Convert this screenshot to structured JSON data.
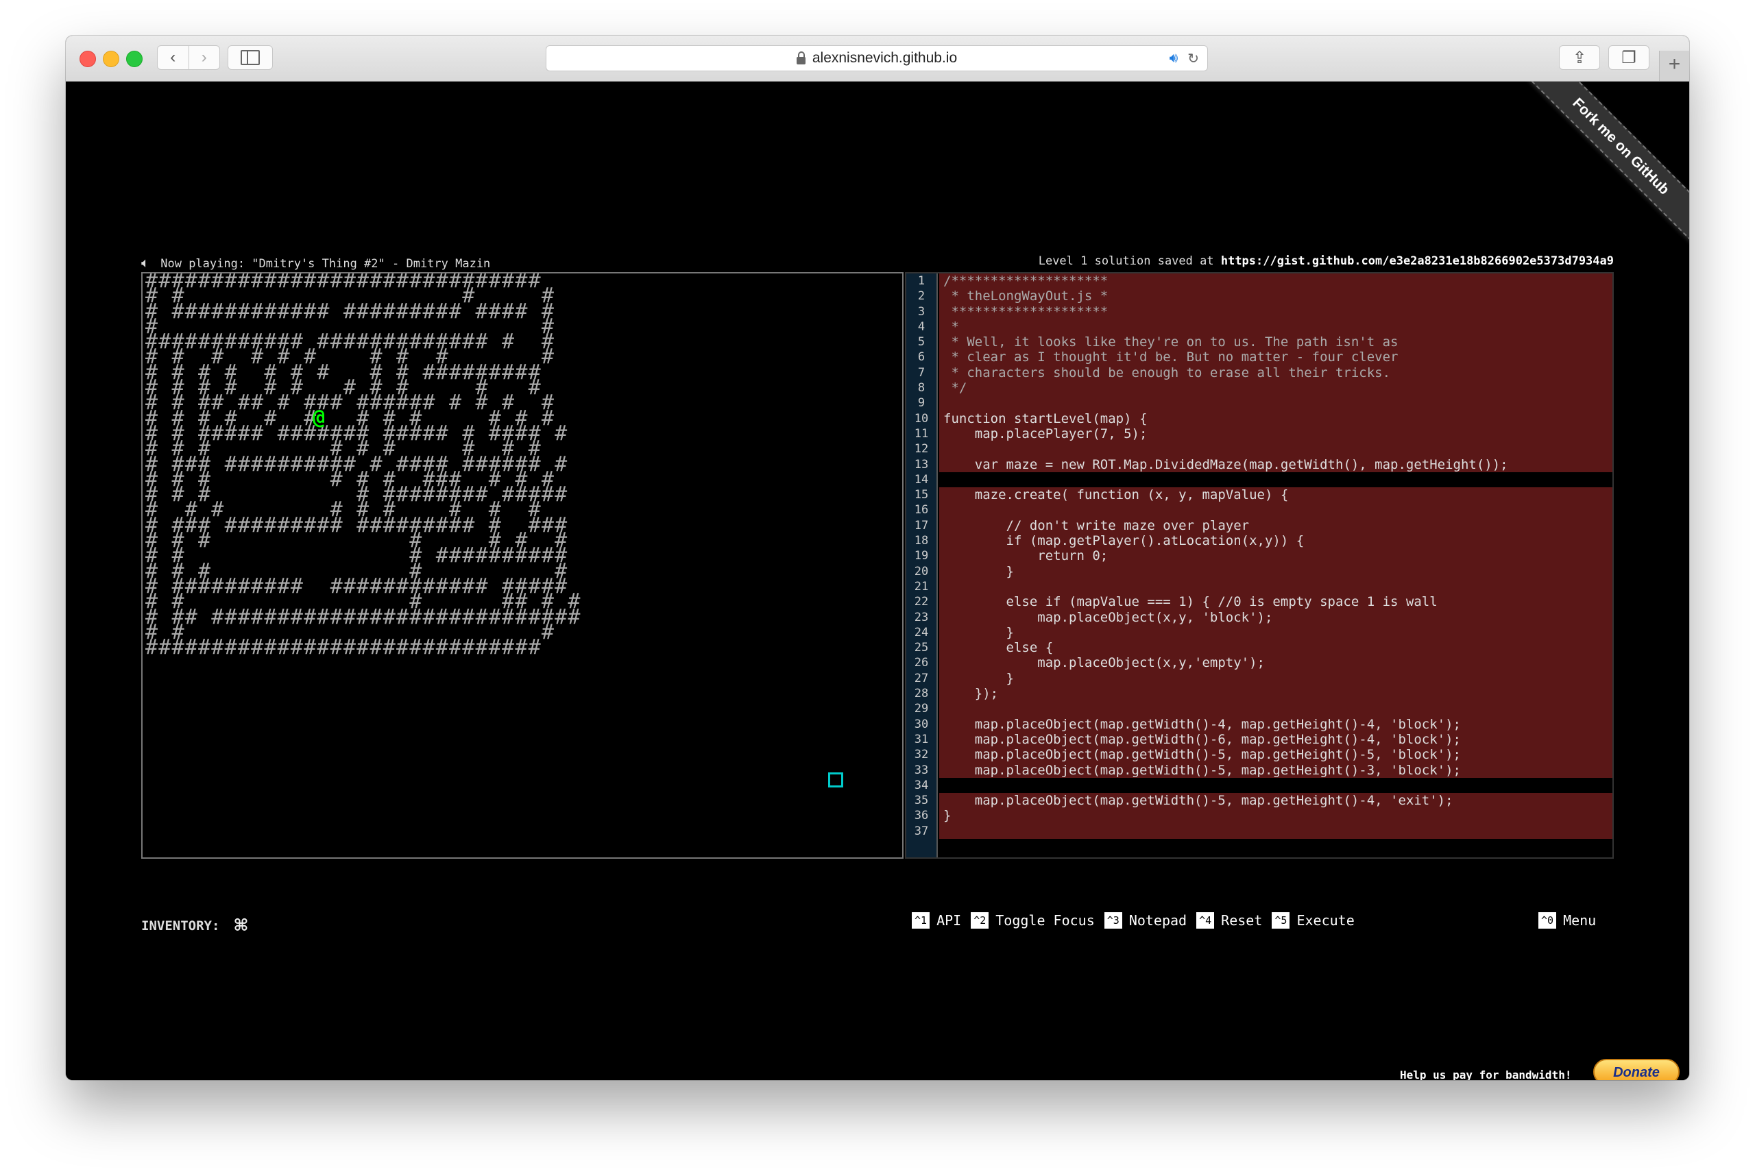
{
  "browser": {
    "url": "alexnisnevich.github.io",
    "icons": {
      "back": "chevron-left-icon",
      "forward": "chevron-right-icon",
      "sidebar": "sidebar-icon",
      "lock": "lock-icon",
      "audio": "speaker-icon",
      "reload": "reload-icon",
      "share": "share-icon",
      "tabs": "tabs-icon",
      "new_tab": "plus-icon"
    }
  },
  "ribbon": {
    "label": "Fork me on GitHub"
  },
  "status": {
    "now_playing": "Now playing: \"Dmitry's Thing #2\" - Dmitry Mazin",
    "saved_prefix": "Level 1 solution saved at",
    "saved_url": "https://gist.github.com/e3e2a8231e18b8266902e5373d7934a9"
  },
  "game": {
    "player_glyph": "@",
    "maze_rows": [
      "##############################",
      "# #                     #     #",
      "# ############ ######### #### #",
      "#                             #",
      "############ ############# #  #",
      "# #  #  # # #    # #  #       #",
      "# # # #  # # #   # # #########",
      "# # # #  # #   # # #     #   #",
      "# # ## ## # ### ###### # # #  #",
      "# # # #  #  #   # # #     # # #",
      "# # ##### ####### ##### # #### #",
      "# # #         # # #     #  # #",
      "# ### ########## # #### ###### #",
      "# # #         # # #  ###  # # #",
      "# # #           # ######## #####",
      "#  # #        # # #    #  #  #",
      "# ### ######### ######### #  ###",
      "# # #               #     # #  #",
      "# #                 # ##########",
      "# # #               #          #",
      "# ##########  ############ #####",
      "# #                 #      ## # #",
      "# ## ############################",
      "# #                           #",
      "##############################"
    ]
  },
  "editor": {
    "lines": [
      {
        "n": "1",
        "text": "/********************",
        "cls": "comment"
      },
      {
        "n": "2",
        "text": " * theLongWayOut.js *",
        "cls": "comment"
      },
      {
        "n": "3",
        "text": " ********************",
        "cls": "comment"
      },
      {
        "n": "4",
        "text": " *",
        "cls": "comment"
      },
      {
        "n": "5",
        "text": " * Well, it looks like they're on to us. The path isn't as",
        "cls": "comment"
      },
      {
        "n": "6",
        "text": " * clear as I thought it'd be. But no matter - four clever",
        "cls": "comment"
      },
      {
        "n": "7",
        "text": " * characters should be enough to erase all their tricks.",
        "cls": "comment"
      },
      {
        "n": "8",
        "text": " */",
        "cls": "comment"
      },
      {
        "n": "9",
        "text": "",
        "cls": ""
      },
      {
        "n": "10",
        "text": "function startLevel(map) {",
        "cls": ""
      },
      {
        "n": "11",
        "text": "    map.placePlayer(7, 5);",
        "cls": ""
      },
      {
        "n": "12",
        "text": "",
        "cls": ""
      },
      {
        "n": "13",
        "text": "    var maze = new ROT.Map.DividedMaze(map.getWidth(), map.getHeight());",
        "cls": ""
      },
      {
        "n": "14",
        "text": "",
        "cls": "editable"
      },
      {
        "n": "15",
        "text": "    maze.create( function (x, y, mapValue) {",
        "cls": ""
      },
      {
        "n": "16",
        "text": "",
        "cls": ""
      },
      {
        "n": "17",
        "text": "        // don't write maze over player",
        "cls": ""
      },
      {
        "n": "18",
        "text": "        if (map.getPlayer().atLocation(x,y)) {",
        "cls": ""
      },
      {
        "n": "19",
        "text": "            return 0;",
        "cls": ""
      },
      {
        "n": "20",
        "text": "        }",
        "cls": ""
      },
      {
        "n": "21",
        "text": "",
        "cls": ""
      },
      {
        "n": "22",
        "text": "        else if (mapValue === 1) { //0 is empty space 1 is wall",
        "cls": ""
      },
      {
        "n": "23",
        "text": "            map.placeObject(x,y, 'block');",
        "cls": ""
      },
      {
        "n": "24",
        "text": "        }",
        "cls": ""
      },
      {
        "n": "25",
        "text": "        else {",
        "cls": ""
      },
      {
        "n": "26",
        "text": "            map.placeObject(x,y,'empty');",
        "cls": ""
      },
      {
        "n": "27",
        "text": "        }",
        "cls": ""
      },
      {
        "n": "28",
        "text": "    });",
        "cls": ""
      },
      {
        "n": "29",
        "text": "",
        "cls": ""
      },
      {
        "n": "30",
        "text": "    map.placeObject(map.getWidth()-4, map.getHeight()-4, 'block');",
        "cls": ""
      },
      {
        "n": "31",
        "text": "    map.placeObject(map.getWidth()-6, map.getHeight()-4, 'block');",
        "cls": ""
      },
      {
        "n": "32",
        "text": "    map.placeObject(map.getWidth()-5, map.getHeight()-5, 'block');",
        "cls": ""
      },
      {
        "n": "33",
        "text": "    map.placeObject(map.getWidth()-5, map.getHeight()-3, 'block');",
        "cls": ""
      },
      {
        "n": "34",
        "text": "",
        "cls": "editable"
      },
      {
        "n": "35",
        "text": "    map.placeObject(map.getWidth()-5, map.getHeight()-4, 'exit');",
        "cls": ""
      },
      {
        "n": "36",
        "text": "}",
        "cls": ""
      },
      {
        "n": "37",
        "text": "",
        "cls": ""
      }
    ]
  },
  "inventory": {
    "label": "INVENTORY:",
    "item_icon": "command-key-icon",
    "item_glyph": "⌘"
  },
  "hotkeys": [
    {
      "key": "^1",
      "label": "API"
    },
    {
      "key": "^2",
      "label": "Toggle Focus"
    },
    {
      "key": "^3",
      "label": "Notepad"
    },
    {
      "key": "^4",
      "label": "Reset"
    },
    {
      "key": "^5",
      "label": "Execute"
    }
  ],
  "menu": {
    "key": "^0",
    "label": "Menu"
  },
  "footer": {
    "bandwidth_text": "Help us pay for bandwidth!",
    "donate_label": "Donate"
  },
  "colors": {
    "code_bg": "#5a1717",
    "gutter_bg": "#0c2233",
    "player": "#00ff00",
    "exit": "#00cccc"
  }
}
